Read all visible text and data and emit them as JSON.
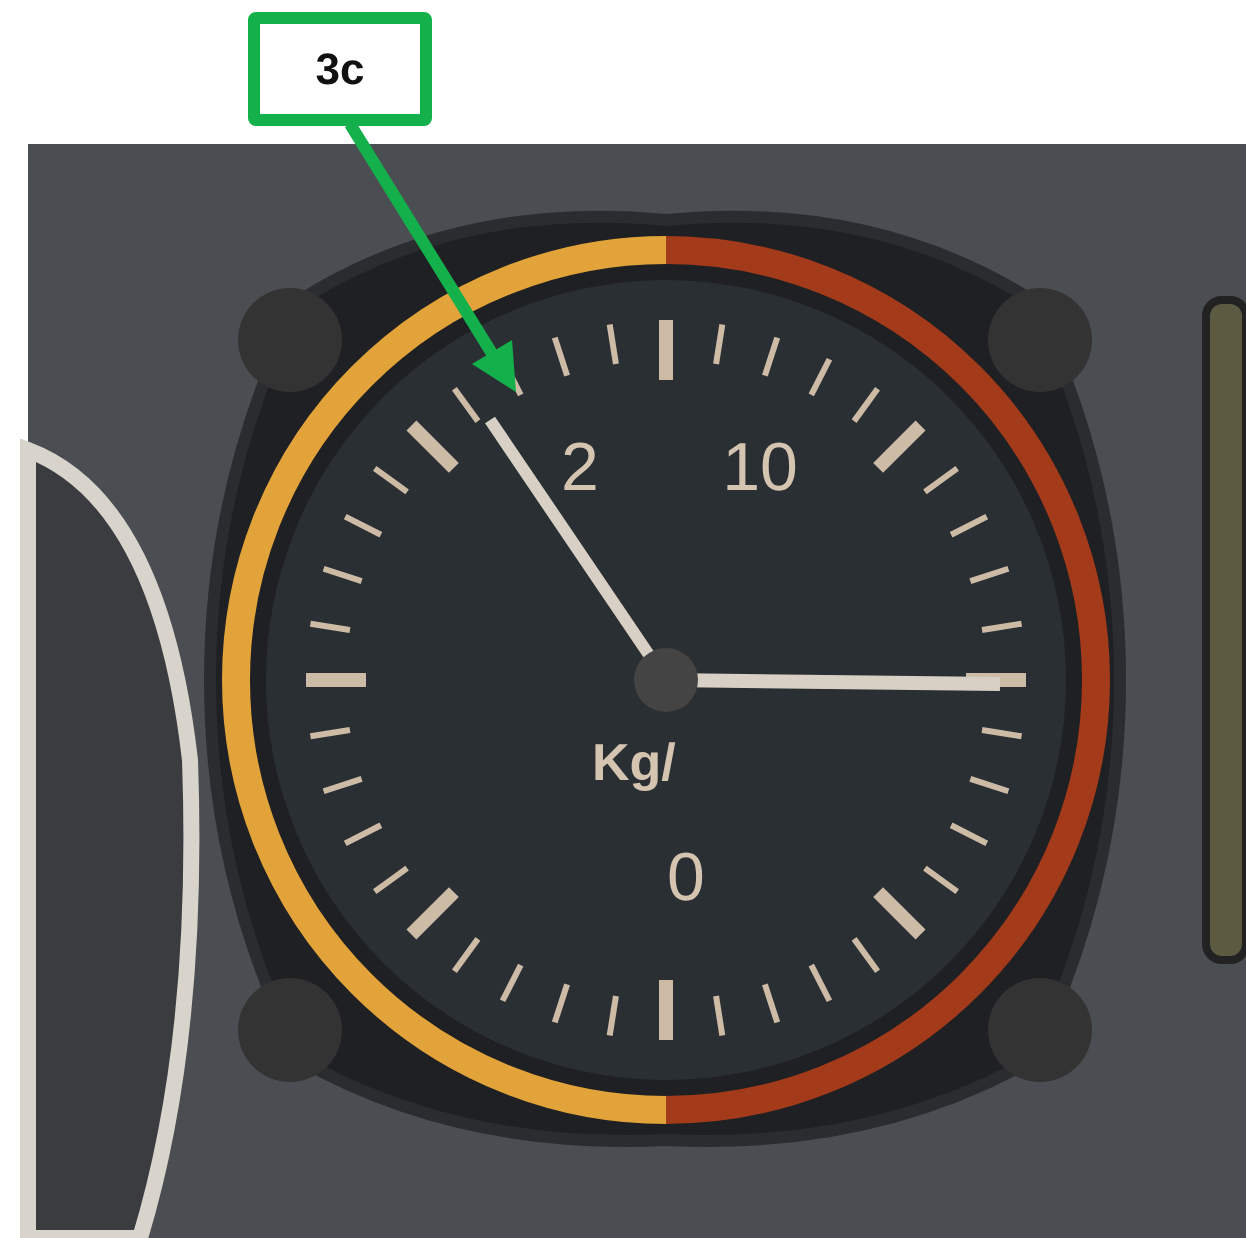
{
  "callout": {
    "label": "3c"
  },
  "gauge": {
    "scale_labels": [
      {
        "text": "2",
        "kind": "left"
      },
      {
        "text": "10",
        "kind": "right"
      },
      {
        "text": "0",
        "kind": "bottom"
      }
    ],
    "unit": "Kg/"
  }
}
